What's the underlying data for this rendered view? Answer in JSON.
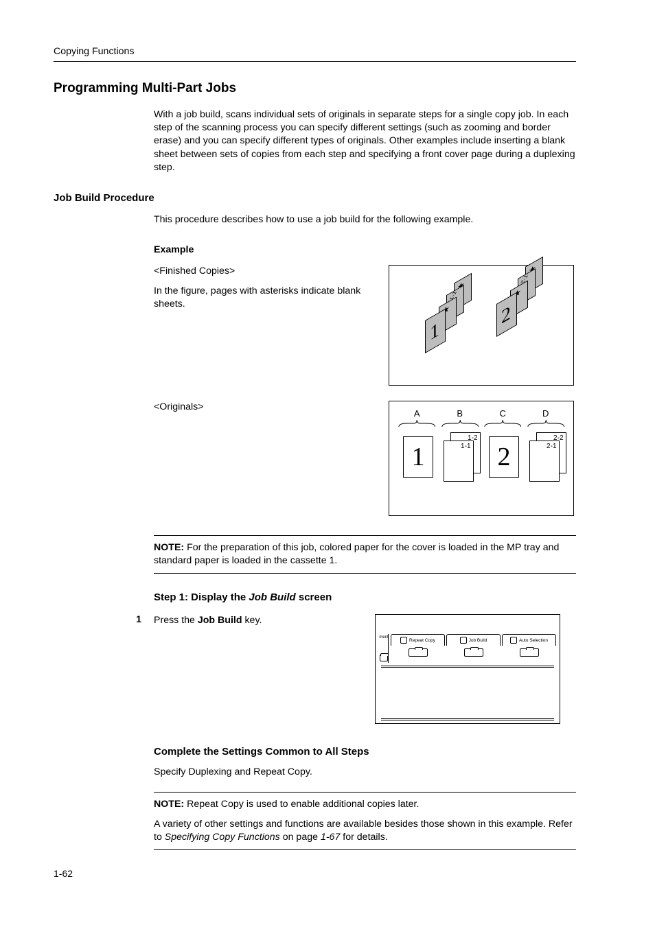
{
  "running_head": "Copying Functions",
  "title": "Programming Multi-Part Jobs",
  "intro": "With a job build, scans individual sets of originals in separate steps for a single copy job. In each step of the scanning process you can specify different settings (such as zooming and border erase) and you can specify different types of originals. Other examples include inserting a blank sheet between sets of copies from each step and specifying a front cover page during a duplexing step.",
  "h2": "Job Build Procedure",
  "proc_intro": "This procedure describes how to use a job build for the following example.",
  "example_label": "Example",
  "finished_label": "<Finished Copies>",
  "finished_text": "In the figure, pages with asterisks indicate blank sheets.",
  "originals_label": "<Originals>",
  "note1_prefix": "NOTE:",
  "note1_text": " For the preparation of this job, colored paper for the cover is loaded in the MP tray and standard paper is loaded in the cassette 1.",
  "step1_head_a": "Step 1: Display the ",
  "step1_head_b": "Job Build",
  "step1_head_c": " screen",
  "step1_num": "1",
  "step1_text_a": "Press the ",
  "step1_text_b": "Job Build",
  "step1_text_c": " key.",
  "common_head": "Complete the Settings Common to All Steps",
  "common_text": "Specify Duplexing and Repeat Copy.",
  "note2_prefix": "NOTE:",
  "note2_text": " Repeat Copy is used to enable additional copies later.",
  "note2_extra_a": "A variety of other settings and functions are available besides those shown in this example. Refer to ",
  "note2_extra_b": "Specifying Copy Functions",
  "note2_extra_c": " on page ",
  "note2_extra_d": "1-67",
  "note2_extra_e": " for details.",
  "page_num": "1-62",
  "fig1": {
    "booklet1": {
      "cover": "1",
      "inner": "1-1"
    },
    "booklet2": {
      "cover": "2",
      "inner": "2-1"
    },
    "star": "★"
  },
  "fig2": {
    "letters": [
      "A",
      "B",
      "C",
      "D"
    ],
    "colA": {
      "big": "1"
    },
    "colB": {
      "back": "1-2",
      "front": "1-1"
    },
    "colC": {
      "big": "2"
    },
    "colD": {
      "back": "2-2",
      "front": "2-1"
    }
  },
  "fig3": {
    "side": "ment",
    "tabs": [
      "Repeat Copy",
      "Job Build",
      "Auto Selection"
    ]
  }
}
